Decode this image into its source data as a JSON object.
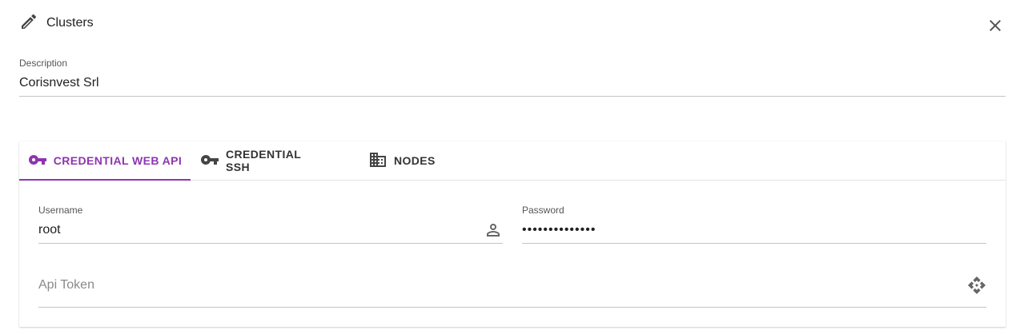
{
  "header": {
    "title": "Clusters",
    "edit_icon": "pencil-icon",
    "close_icon": "close-icon"
  },
  "description": {
    "label": "Description",
    "value": "Corisnvest Srl"
  },
  "tabs": [
    {
      "label": "CREDENTIAL WEB API",
      "icon": "key-icon",
      "active": true
    },
    {
      "label": "CREDENTIAL SSH",
      "icon": "key-icon",
      "active": false
    },
    {
      "label": "NODES",
      "icon": "building-icon",
      "active": false
    }
  ],
  "credential_web_api": {
    "username": {
      "label": "Username",
      "value": "root",
      "icon": "account-icon"
    },
    "password": {
      "label": "Password",
      "value": "••••••••••••••"
    },
    "api_token": {
      "placeholder": "Api Token",
      "icon": "api-icon"
    }
  },
  "colors": {
    "accent": "#8e35b0",
    "text": "#212121",
    "underline": "#c4c4c4"
  }
}
